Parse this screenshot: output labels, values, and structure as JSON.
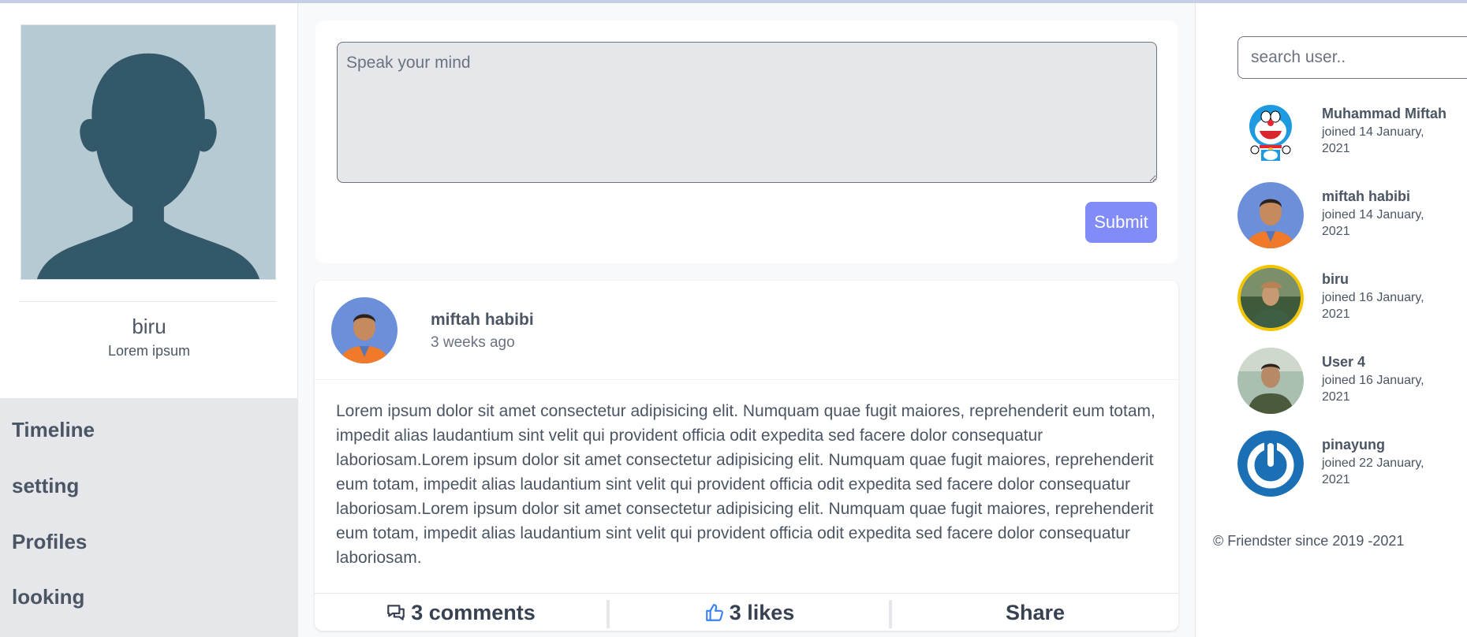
{
  "profile": {
    "name": "biru",
    "subtitle": "Lorem ipsum"
  },
  "nav": {
    "items": [
      "Timeline",
      "setting",
      "Profiles",
      "looking"
    ]
  },
  "composer": {
    "placeholder": "Speak your mind",
    "submit_label": "Submit"
  },
  "post": {
    "author": "miftah habibi",
    "time": "3 weeks ago",
    "body": "Lorem ipsum dolor sit amet consectetur adipisicing elit. Numquam quae fugit maiores, reprehenderit eum totam, impedit alias laudantium sint velit qui provident officia odit expedita sed facere dolor consequatur laboriosam.Lorem ipsum dolor sit amet consectetur adipisicing elit. Numquam quae fugit maiores, reprehenderit eum totam, impedit alias laudantium sint velit qui provident officia odit expedita sed facere dolor consequatur laboriosam.Lorem ipsum dolor sit amet consectetur adipisicing elit. Numquam quae fugit maiores, reprehenderit eum totam, impedit alias laudantium sint velit qui provident officia odit expedita sed facere dolor consequatur laboriosam.",
    "comments_label": "3 comments",
    "likes_label": "3 likes",
    "share_label": "Share"
  },
  "search": {
    "placeholder": "search user.."
  },
  "users": [
    {
      "name": "Muhammad Miftah",
      "joined": "joined 14 January, 2021"
    },
    {
      "name": "miftah habibi",
      "joined": "joined 14 January, 2021"
    },
    {
      "name": "biru",
      "joined": "joined 16 January, 2021"
    },
    {
      "name": "User 4",
      "joined": "joined 16 January, 2021"
    },
    {
      "name": "pinayung",
      "joined": "joined 22 January, 2021"
    }
  ],
  "footer": {
    "text": "© Friendster since 2019 -2021"
  },
  "colors": {
    "accent": "#818cf8",
    "like_icon": "#3b82f6",
    "nav_bg": "#e5e7eb"
  }
}
